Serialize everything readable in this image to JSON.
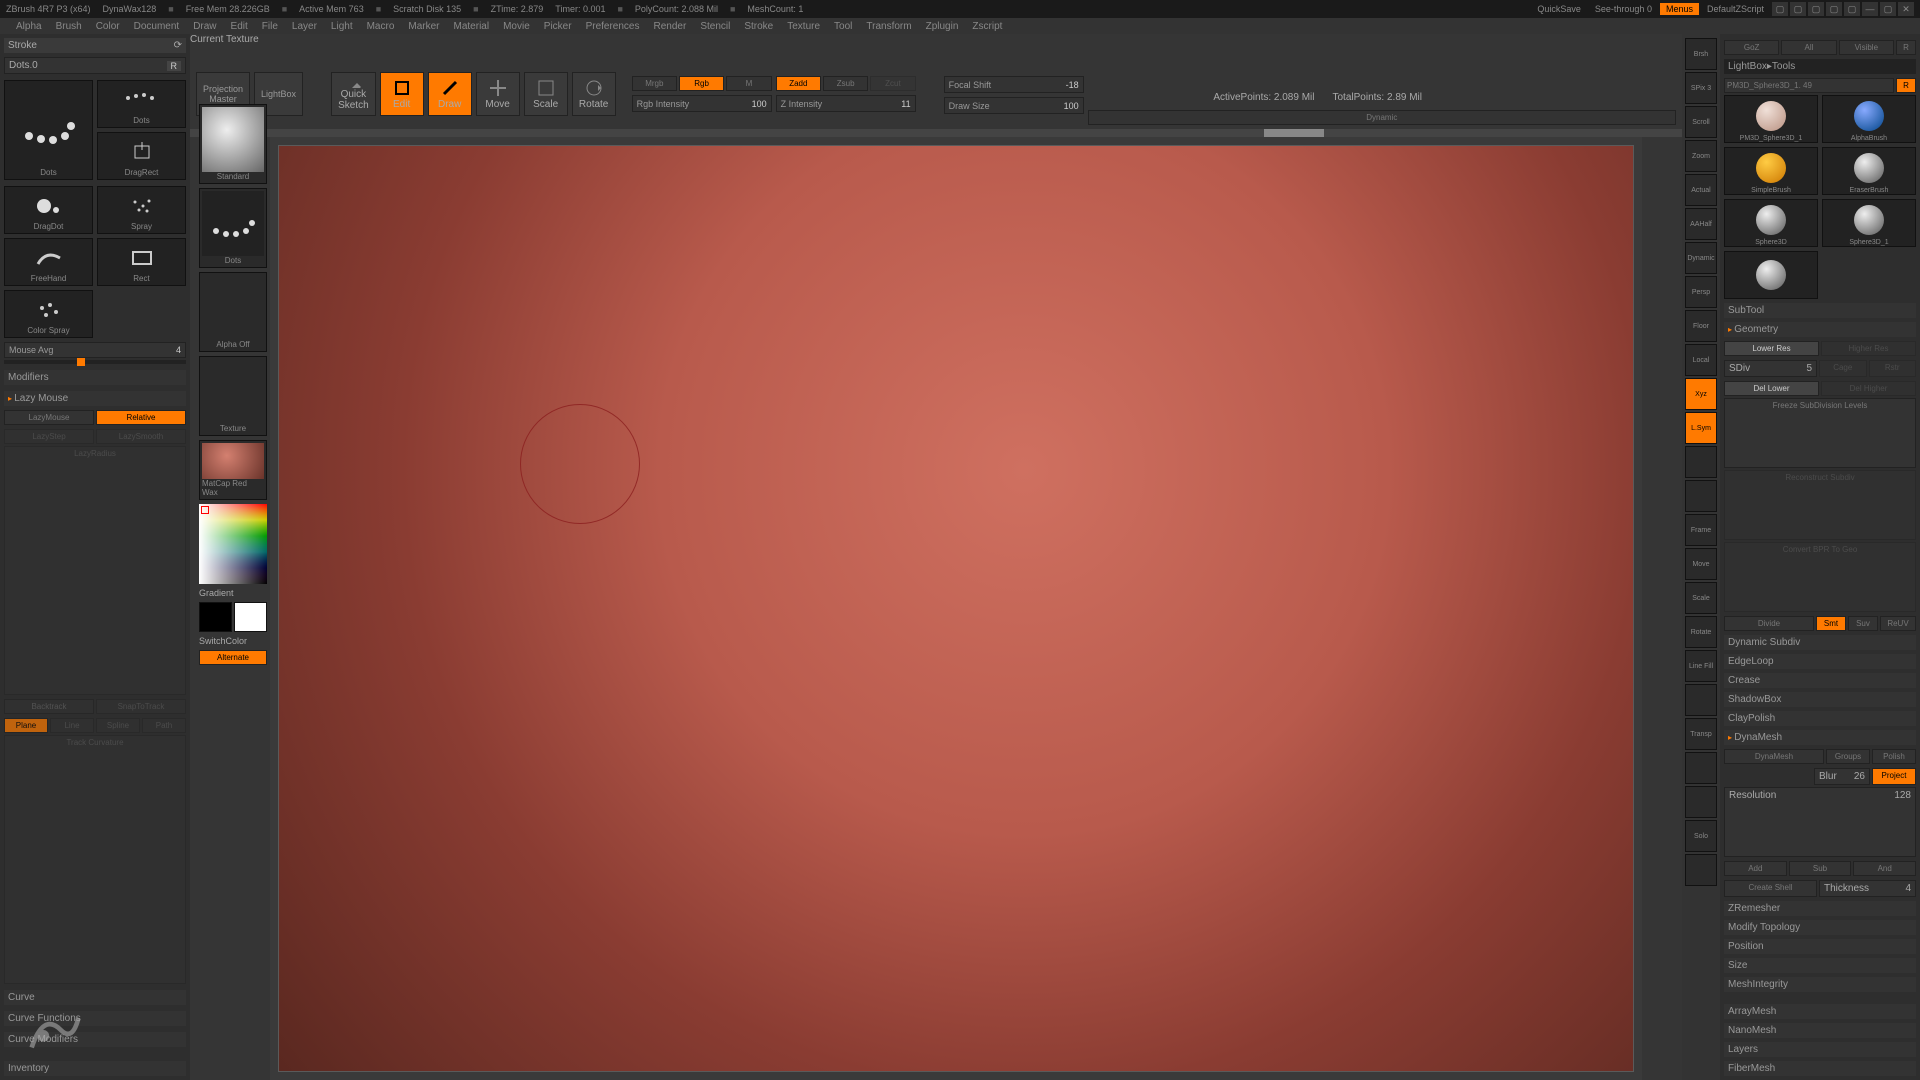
{
  "title": {
    "app": "ZBrush 4R7 P3 (x64)",
    "project": "DynaWax128",
    "mem": "Free Mem 28.226GB",
    "active": "Active Mem 763",
    "scratch": "Scratch Disk 135",
    "ztime": "ZTime: 2.879",
    "timer": "Timer: 0.001",
    "poly": "PolyCount: 2.088 Mil",
    "mesh": "MeshCount: 1"
  },
  "titleright": {
    "quicksave": "QuickSave",
    "see": "See-through  0",
    "menus": "Menus",
    "default": "DefaultZScript"
  },
  "menu": [
    "Alpha",
    "Brush",
    "Color",
    "Document",
    "Draw",
    "Edit",
    "File",
    "Layer",
    "Light",
    "Macro",
    "Marker",
    "Material",
    "Movie",
    "Picker",
    "Preferences",
    "Render",
    "Stencil",
    "Stroke",
    "Texture",
    "Tool",
    "Transform",
    "Zplugin",
    "Zscript"
  ],
  "left": {
    "header": "Stroke",
    "dots": {
      "label": "Dots",
      "val": "0",
      "r": "R"
    },
    "strokes": {
      "dots": "Dots",
      "dragrect": "DragRect",
      "dragdot": "DragDot",
      "spray": "Spray",
      "freehand": "FreeHand",
      "rect": "Rect",
      "colorspray": "Color Spray"
    },
    "mouseavg": {
      "label": "Mouse Avg",
      "val": "4"
    },
    "modifiers": "Modifiers",
    "lazymouse": "Lazy Mouse",
    "lazybtn": {
      "lazy": "LazyMouse",
      "rel": "Relative"
    },
    "lazystep": "LazyStep",
    "lazysmooth": "LazySmooth",
    "lazyradius": "LazyRadius",
    "backtrack": "Backtrack",
    "snap": "SnapToTrack",
    "plane": "Plane",
    "line": "Line",
    "spline": "Spline",
    "path": "Path",
    "track": "Track Curvature",
    "curve": "Curve",
    "curvefn": "Curve Functions",
    "curvemod": "Curve Modifiers",
    "inventory": "Inventory"
  },
  "toolhdr": {
    "label": "Current Texture",
    "proj": "Projection\nMaster",
    "lightbox": "LightBox",
    "qsketch": "Quick\nSketch",
    "edit": "Edit",
    "draw": "Draw",
    "move": "Move",
    "scale": "Scale",
    "rotate": "Rotate",
    "mrgb": "Mrgb",
    "rgb": "Rgb",
    "m": "M",
    "rgbint": {
      "label": "Rgb Intensity",
      "val": "100"
    },
    "zadd": "Zadd",
    "zsub": "Zsub",
    "zcut": "Zcut",
    "zint": {
      "label": "Z Intensity",
      "val": "11"
    },
    "focal": {
      "label": "Focal Shift",
      "val": "-18"
    },
    "draws": {
      "label": "Draw Size",
      "val": "100"
    },
    "dynamic": "Dynamic"
  },
  "stats": {
    "active": "ActivePoints: 2.089 Mil",
    "total": "TotalPoints: 2.89 Mil"
  },
  "lefttools": {
    "standard": "Standard",
    "dots": "Dots",
    "alpha": "Alpha Off",
    "texture": "Texture",
    "matcap": "MatCap Red Wax",
    "gradient": "Gradient",
    "switch": "SwitchColor",
    "alternate": "Alternate"
  },
  "rshelf": [
    "Brsh",
    "SPix 3",
    "Scroll",
    "Zoom",
    "Actual",
    "AAHalf",
    "Dynamic",
    "Persp",
    "Floor",
    "Local",
    "Xyz",
    "L.Sym",
    "",
    "",
    "Frame",
    "Move",
    "Scale",
    "Rotate",
    "Line Fill",
    "",
    "Transp",
    "",
    "",
    "Solo",
    ""
  ],
  "rshelf_on": [
    10,
    11
  ],
  "right": {
    "tabs": {
      "goz": "GoZ",
      "all": "All",
      "visible": "Visible",
      "r": "R"
    },
    "lightbox": "LightBox▸Tools",
    "toolname": "PM3D_Sphere3D_1. 49",
    "r": "R",
    "tools": [
      "PM3D_Sphere3D_1",
      "AlphaBrush",
      "SimpleBrush",
      "EraserBrush",
      "Sphere3D",
      "Sphere3D_1",
      ""
    ],
    "subtool": "SubTool",
    "geometry": "Geometry",
    "lowres": "Lower Res",
    "highres": "Higher Res",
    "sdiv": {
      "label": "SDiv",
      "val": "5"
    },
    "cage": "Cage",
    "rstr": "Rstr",
    "dellower": "Del Lower",
    "delhigher": "Del Higher",
    "freeze": "Freeze SubDivision Levels",
    "recon": "Reconstruct Subdiv",
    "convert": "Convert BPR To Geo",
    "divide": "Divide",
    "smt": "Smt",
    "suv": "Suv",
    "reuv": "ReUV",
    "dynsub": "Dynamic Subdiv",
    "edgeloop": "EdgeLoop",
    "crease": "Crease",
    "shadowbox": "ShadowBox",
    "claypolish": "ClayPolish",
    "dynamesh": "DynaMesh",
    "dynameshbtn": "DynaMesh",
    "groups": "Groups",
    "polish": "Polish",
    "blur": {
      "label": "Blur",
      "val": "26"
    },
    "project": "Project",
    "res": {
      "label": "Resolution",
      "val": "128"
    },
    "add": "Add",
    "sub": "Sub",
    "and": "And",
    "createshell": "Create Shell",
    "thickness": {
      "label": "Thickness",
      "val": "4"
    },
    "zremesher": "ZRemesher",
    "modtopo": "Modify Topology",
    "position": "Position",
    "size": "Size",
    "meshint": "MeshIntegrity",
    "arraymesh": "ArrayMesh",
    "nanomesh": "NanoMesh",
    "layers": "Layers",
    "fibermesh": "FiberMesh"
  }
}
